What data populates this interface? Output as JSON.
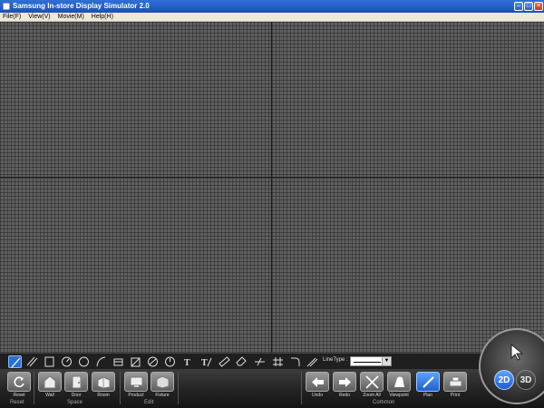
{
  "window": {
    "title": "Samsung In-store Display Simulator 2.0"
  },
  "menu": [
    "File(F)",
    "View(V)",
    "Movie(M)",
    "Help(H)"
  ],
  "drawbar": {
    "linetype_label": "LineType :"
  },
  "buttons": {
    "reset": "Reset",
    "wall": "Wall",
    "door": "Door",
    "room": "Room",
    "product": "Product",
    "fixture": "Fixture",
    "undo": "Undo",
    "redo": "Redo",
    "zoom_all": "Zoom All",
    "viewpoint": "Viewpoint",
    "plan": "Plan",
    "print": "Print"
  },
  "groups": {
    "reset": "Reset",
    "space": "Space",
    "edit": "Edit",
    "common": "Common"
  },
  "view_toggle": {
    "mode_2d": "2D",
    "mode_3d": "3D"
  },
  "colors": {
    "accent": "#2c6fd1",
    "titlebar": "#1b4fb5",
    "canvas": "#5f5f5f"
  }
}
